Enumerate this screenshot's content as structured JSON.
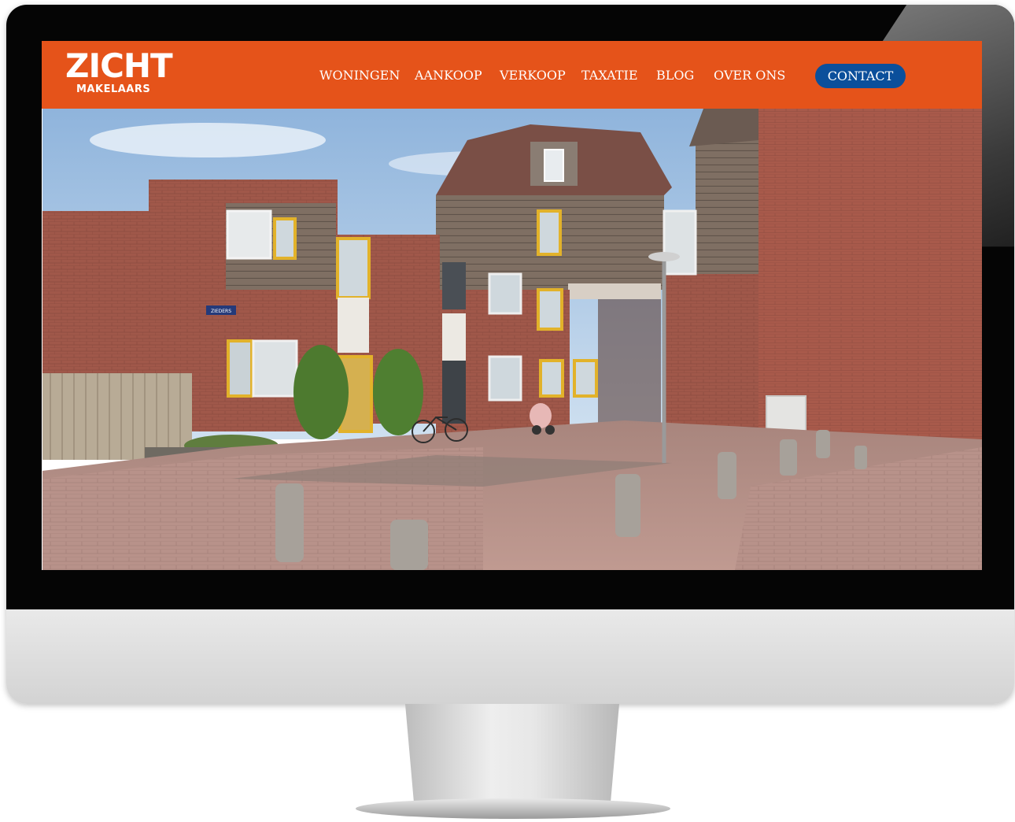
{
  "brand": {
    "name": "ZICHT",
    "sub": "MAKELAARS"
  },
  "nav": {
    "items": [
      {
        "label": "WONINGEN"
      },
      {
        "label": "AANKOOP"
      },
      {
        "label": "VERKOOP"
      },
      {
        "label": "TAXATIE"
      },
      {
        "label": "BLOG"
      },
      {
        "label": "OVER ONS"
      }
    ],
    "contact_label": "CONTACT"
  },
  "hero": {
    "street_sign": "ZIEDERS"
  },
  "colors": {
    "header": "#e5531a",
    "contact_button": "#0b4f9b",
    "text": "#ffffff"
  }
}
